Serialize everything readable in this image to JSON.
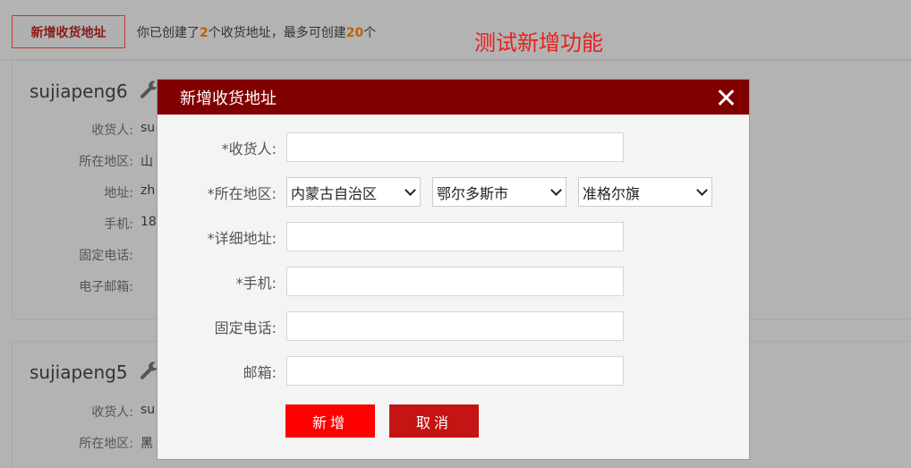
{
  "page": {
    "add_button": "新增收货地址",
    "summary_prefix": "你已创建了",
    "summary_count": "2",
    "summary_mid": "个收货地址，最多可创建",
    "summary_max": "20",
    "summary_suffix": "个",
    "test_label": "测试新增功能"
  },
  "cards": [
    {
      "name": "sujiapeng6",
      "fields": [
        {
          "label": "收货人:",
          "value": "su"
        },
        {
          "label": "所在地区:",
          "value": "山"
        },
        {
          "label": "地址:",
          "value": "zh"
        },
        {
          "label": "手机:",
          "value": "18"
        },
        {
          "label": "固定电话:",
          "value": ""
        },
        {
          "label": "电子邮箱:",
          "value": ""
        }
      ]
    },
    {
      "name": "sujiapeng5",
      "fields": [
        {
          "label": "收货人:",
          "value": "su"
        },
        {
          "label": "所在地区:",
          "value": "黑"
        }
      ]
    }
  ],
  "modal": {
    "title": "新增收货地址",
    "labels": {
      "receiver": "*收货人:",
      "region": "*所在地区:",
      "detail": "*详细地址:",
      "mobile": "*手机:",
      "phone": "固定电话:",
      "email": "邮箱:"
    },
    "values": {
      "receiver": "",
      "detail": "",
      "mobile": "",
      "phone": "",
      "email": ""
    },
    "province": "内蒙古自治区",
    "city": "鄂尔多斯市",
    "district": "准格尔旗",
    "submit": "新增",
    "cancel": "取消"
  },
  "colors": {
    "header": "#800000",
    "submit": "#ff0000",
    "cancel": "#c41414",
    "test_label": "#e8201c",
    "count": "#c06000"
  },
  "icons": {
    "edit": "wrench-icon",
    "close": "close-icon",
    "dropdown": "chevron-down-icon"
  }
}
